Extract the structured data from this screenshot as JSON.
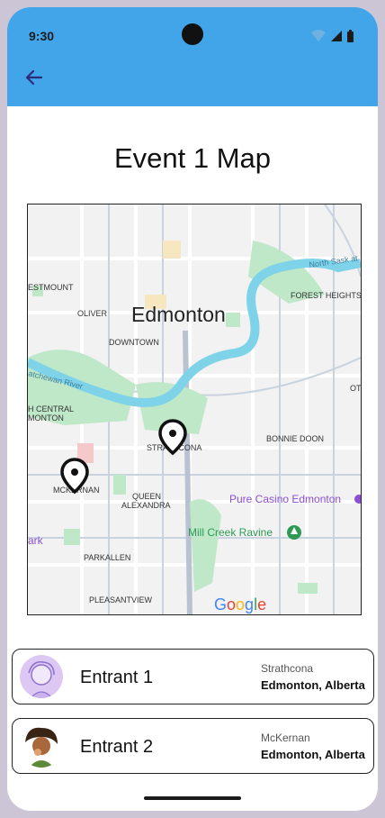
{
  "status_bar": {
    "time": "9:30"
  },
  "page": {
    "title": "Event 1 Map"
  },
  "map": {
    "city_label": "Edmonton",
    "neighbourhoods": [
      "ESTMOUNT",
      "OLIVER",
      "DOWNTOWN",
      "FOREST HEIGHTS",
      "H CENTRAL",
      "MONTON",
      "STRATHCONA",
      "BONNIE DOON",
      "MCKERNAN",
      "QUEEN",
      "ALEXANDRA",
      "PARKALLEN",
      "PLEASANTVIEW",
      "OT"
    ],
    "river_labels": [
      "atchewan River",
      "North Sask at"
    ],
    "pois": [
      "Pure Casino Edmonton",
      "Mill Creek Ravine",
      "ark"
    ],
    "attribution": "Google",
    "marker_icon": "location-pin-icon"
  },
  "entrants": [
    {
      "name": "Entrant 1",
      "neighbourhood": "Strathcona",
      "location": "Edmonton, Alberta",
      "avatar": "illustrated-avatar-purple"
    },
    {
      "name": "Entrant 2",
      "neighbourhood": "McKernan",
      "location": "Edmonton, Alberta",
      "avatar": "illustrated-avatar-curly-hair"
    }
  ],
  "colors": {
    "app_bar": "#42a5ea",
    "river": "#7fd3e8",
    "park": "#bfe8c8",
    "poi": "#8d4fd4",
    "park_poi": "#2f9a55"
  }
}
